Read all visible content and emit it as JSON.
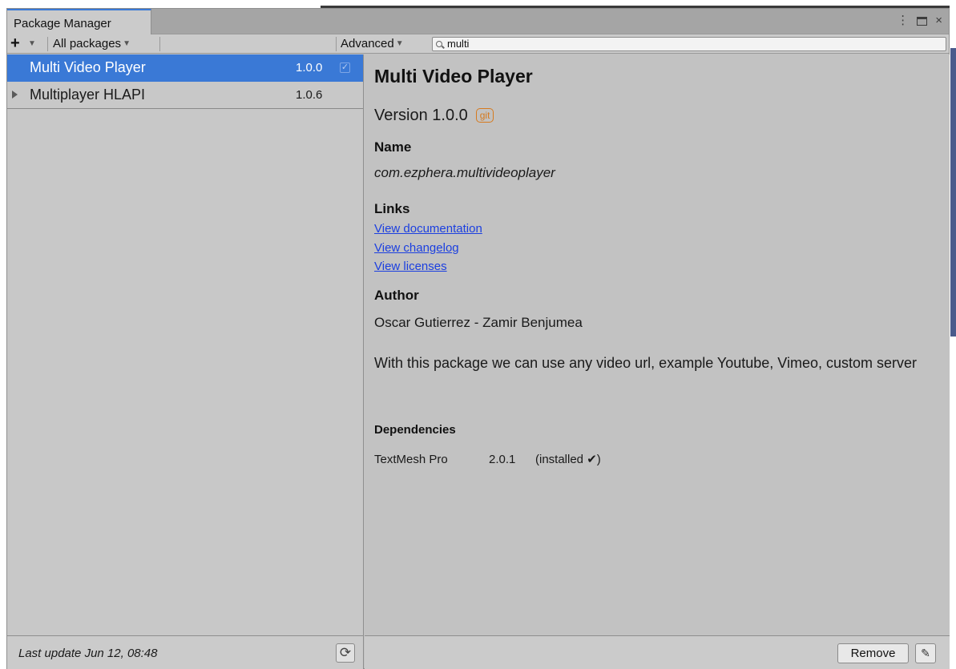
{
  "window": {
    "tab_title": "Package Manager",
    "controls": {
      "menu": "⋮",
      "close": "×"
    }
  },
  "toolbar": {
    "add_label": "+",
    "filter_label": "All packages",
    "advanced_label": "Advanced",
    "search_value": "multi"
  },
  "packages": [
    {
      "name": "Multi Video Player",
      "version": "1.0.0",
      "selected": true
    },
    {
      "name": "Multiplayer HLAPI",
      "version": "1.0.6",
      "selected": false
    }
  ],
  "detail": {
    "title": "Multi Video Player",
    "version": "Version 1.0.0",
    "source_badge": "git",
    "name_label": "Name",
    "name_value": "com.ezphera.multivideoplayer",
    "links_label": "Links",
    "links": [
      "View documentation",
      "View changelog",
      "View licenses"
    ],
    "author_label": "Author",
    "author_value": "Oscar Gutierrez - Zamir Benjumea",
    "description": "With this package we can use any video url, example Youtube, Vimeo, custom server",
    "dependencies_label": "Dependencies",
    "dependencies": [
      {
        "name": "TextMesh Pro",
        "version": "2.0.1",
        "status": "(installed ✔)"
      }
    ]
  },
  "status": {
    "last_update": "Last update Jun 12, 08:48",
    "remove_label": "Remove"
  }
}
